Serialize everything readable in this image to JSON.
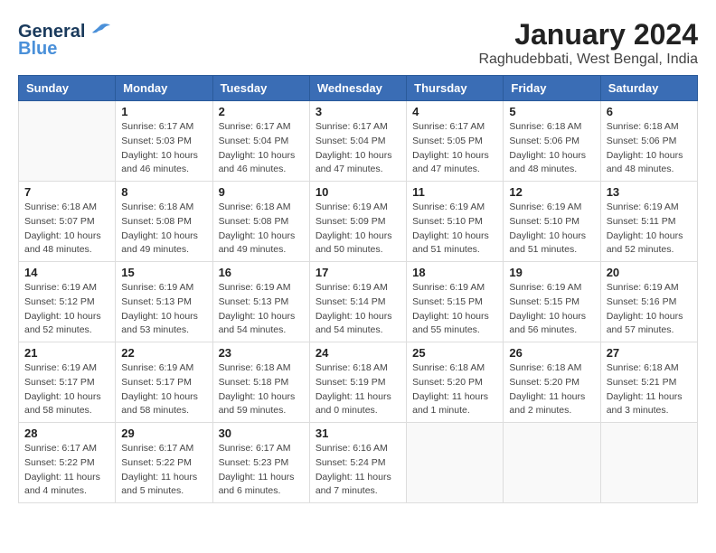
{
  "header": {
    "title": "January 2024",
    "subtitle": "Raghudebbati, West Bengal, India",
    "logo_general": "General",
    "logo_blue": "Blue"
  },
  "days_of_week": [
    "Sunday",
    "Monday",
    "Tuesday",
    "Wednesday",
    "Thursday",
    "Friday",
    "Saturday"
  ],
  "weeks": [
    [
      {
        "day": "",
        "info": ""
      },
      {
        "day": "1",
        "sunrise": "Sunrise: 6:17 AM",
        "sunset": "Sunset: 5:03 PM",
        "daylight": "Daylight: 10 hours and 46 minutes."
      },
      {
        "day": "2",
        "sunrise": "Sunrise: 6:17 AM",
        "sunset": "Sunset: 5:04 PM",
        "daylight": "Daylight: 10 hours and 46 minutes."
      },
      {
        "day": "3",
        "sunrise": "Sunrise: 6:17 AM",
        "sunset": "Sunset: 5:04 PM",
        "daylight": "Daylight: 10 hours and 47 minutes."
      },
      {
        "day": "4",
        "sunrise": "Sunrise: 6:17 AM",
        "sunset": "Sunset: 5:05 PM",
        "daylight": "Daylight: 10 hours and 47 minutes."
      },
      {
        "day": "5",
        "sunrise": "Sunrise: 6:18 AM",
        "sunset": "Sunset: 5:06 PM",
        "daylight": "Daylight: 10 hours and 48 minutes."
      },
      {
        "day": "6",
        "sunrise": "Sunrise: 6:18 AM",
        "sunset": "Sunset: 5:06 PM",
        "daylight": "Daylight: 10 hours and 48 minutes."
      }
    ],
    [
      {
        "day": "7",
        "sunrise": "Sunrise: 6:18 AM",
        "sunset": "Sunset: 5:07 PM",
        "daylight": "Daylight: 10 hours and 48 minutes."
      },
      {
        "day": "8",
        "sunrise": "Sunrise: 6:18 AM",
        "sunset": "Sunset: 5:08 PM",
        "daylight": "Daylight: 10 hours and 49 minutes."
      },
      {
        "day": "9",
        "sunrise": "Sunrise: 6:18 AM",
        "sunset": "Sunset: 5:08 PM",
        "daylight": "Daylight: 10 hours and 49 minutes."
      },
      {
        "day": "10",
        "sunrise": "Sunrise: 6:19 AM",
        "sunset": "Sunset: 5:09 PM",
        "daylight": "Daylight: 10 hours and 50 minutes."
      },
      {
        "day": "11",
        "sunrise": "Sunrise: 6:19 AM",
        "sunset": "Sunset: 5:10 PM",
        "daylight": "Daylight: 10 hours and 51 minutes."
      },
      {
        "day": "12",
        "sunrise": "Sunrise: 6:19 AM",
        "sunset": "Sunset: 5:10 PM",
        "daylight": "Daylight: 10 hours and 51 minutes."
      },
      {
        "day": "13",
        "sunrise": "Sunrise: 6:19 AM",
        "sunset": "Sunset: 5:11 PM",
        "daylight": "Daylight: 10 hours and 52 minutes."
      }
    ],
    [
      {
        "day": "14",
        "sunrise": "Sunrise: 6:19 AM",
        "sunset": "Sunset: 5:12 PM",
        "daylight": "Daylight: 10 hours and 52 minutes."
      },
      {
        "day": "15",
        "sunrise": "Sunrise: 6:19 AM",
        "sunset": "Sunset: 5:13 PM",
        "daylight": "Daylight: 10 hours and 53 minutes."
      },
      {
        "day": "16",
        "sunrise": "Sunrise: 6:19 AM",
        "sunset": "Sunset: 5:13 PM",
        "daylight": "Daylight: 10 hours and 54 minutes."
      },
      {
        "day": "17",
        "sunrise": "Sunrise: 6:19 AM",
        "sunset": "Sunset: 5:14 PM",
        "daylight": "Daylight: 10 hours and 54 minutes."
      },
      {
        "day": "18",
        "sunrise": "Sunrise: 6:19 AM",
        "sunset": "Sunset: 5:15 PM",
        "daylight": "Daylight: 10 hours and 55 minutes."
      },
      {
        "day": "19",
        "sunrise": "Sunrise: 6:19 AM",
        "sunset": "Sunset: 5:15 PM",
        "daylight": "Daylight: 10 hours and 56 minutes."
      },
      {
        "day": "20",
        "sunrise": "Sunrise: 6:19 AM",
        "sunset": "Sunset: 5:16 PM",
        "daylight": "Daylight: 10 hours and 57 minutes."
      }
    ],
    [
      {
        "day": "21",
        "sunrise": "Sunrise: 6:19 AM",
        "sunset": "Sunset: 5:17 PM",
        "daylight": "Daylight: 10 hours and 58 minutes."
      },
      {
        "day": "22",
        "sunrise": "Sunrise: 6:19 AM",
        "sunset": "Sunset: 5:17 PM",
        "daylight": "Daylight: 10 hours and 58 minutes."
      },
      {
        "day": "23",
        "sunrise": "Sunrise: 6:18 AM",
        "sunset": "Sunset: 5:18 PM",
        "daylight": "Daylight: 10 hours and 59 minutes."
      },
      {
        "day": "24",
        "sunrise": "Sunrise: 6:18 AM",
        "sunset": "Sunset: 5:19 PM",
        "daylight": "Daylight: 11 hours and 0 minutes."
      },
      {
        "day": "25",
        "sunrise": "Sunrise: 6:18 AM",
        "sunset": "Sunset: 5:20 PM",
        "daylight": "Daylight: 11 hours and 1 minute."
      },
      {
        "day": "26",
        "sunrise": "Sunrise: 6:18 AM",
        "sunset": "Sunset: 5:20 PM",
        "daylight": "Daylight: 11 hours and 2 minutes."
      },
      {
        "day": "27",
        "sunrise": "Sunrise: 6:18 AM",
        "sunset": "Sunset: 5:21 PM",
        "daylight": "Daylight: 11 hours and 3 minutes."
      }
    ],
    [
      {
        "day": "28",
        "sunrise": "Sunrise: 6:17 AM",
        "sunset": "Sunset: 5:22 PM",
        "daylight": "Daylight: 11 hours and 4 minutes."
      },
      {
        "day": "29",
        "sunrise": "Sunrise: 6:17 AM",
        "sunset": "Sunset: 5:22 PM",
        "daylight": "Daylight: 11 hours and 5 minutes."
      },
      {
        "day": "30",
        "sunrise": "Sunrise: 6:17 AM",
        "sunset": "Sunset: 5:23 PM",
        "daylight": "Daylight: 11 hours and 6 minutes."
      },
      {
        "day": "31",
        "sunrise": "Sunrise: 6:16 AM",
        "sunset": "Sunset: 5:24 PM",
        "daylight": "Daylight: 11 hours and 7 minutes."
      },
      {
        "day": "",
        "info": ""
      },
      {
        "day": "",
        "info": ""
      },
      {
        "day": "",
        "info": ""
      }
    ]
  ]
}
